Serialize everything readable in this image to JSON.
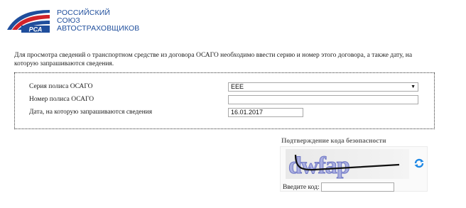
{
  "header": {
    "logo_icon": "rsa-flag-logo-icon",
    "logo_text": "РСА",
    "brand_line1": "РОССИЙСКИЙ",
    "brand_line2": "СОЮЗ",
    "brand_line3": "АВТОСТРАХОВЩИКОВ"
  },
  "intro_line1": "Для просмотра сведений о транспортном средстве из договора ОСАГО необходимо ввести серию и номер этого договора, а также дату, на",
  "intro_line2": "которую запрашиваются сведения.",
  "form": {
    "series_label": "Серия полиса ОСАГО",
    "series_value": "ЕЕЕ",
    "number_label": "Номер полиса ОСАГО",
    "number_value": "",
    "date_label": "Дата, на которую запрашиваются сведения",
    "date_value": "16.01.2017"
  },
  "captcha": {
    "title": "Подтверждение кода безопасности",
    "image_text": "dwfap",
    "refresh_icon": "refresh-icon",
    "code_label": "Введите код:",
    "code_value": ""
  },
  "colors": {
    "brand_blue": "#1f4e9c",
    "flag_red": "#d2232a",
    "refresh_blue": "#1e88e5"
  }
}
